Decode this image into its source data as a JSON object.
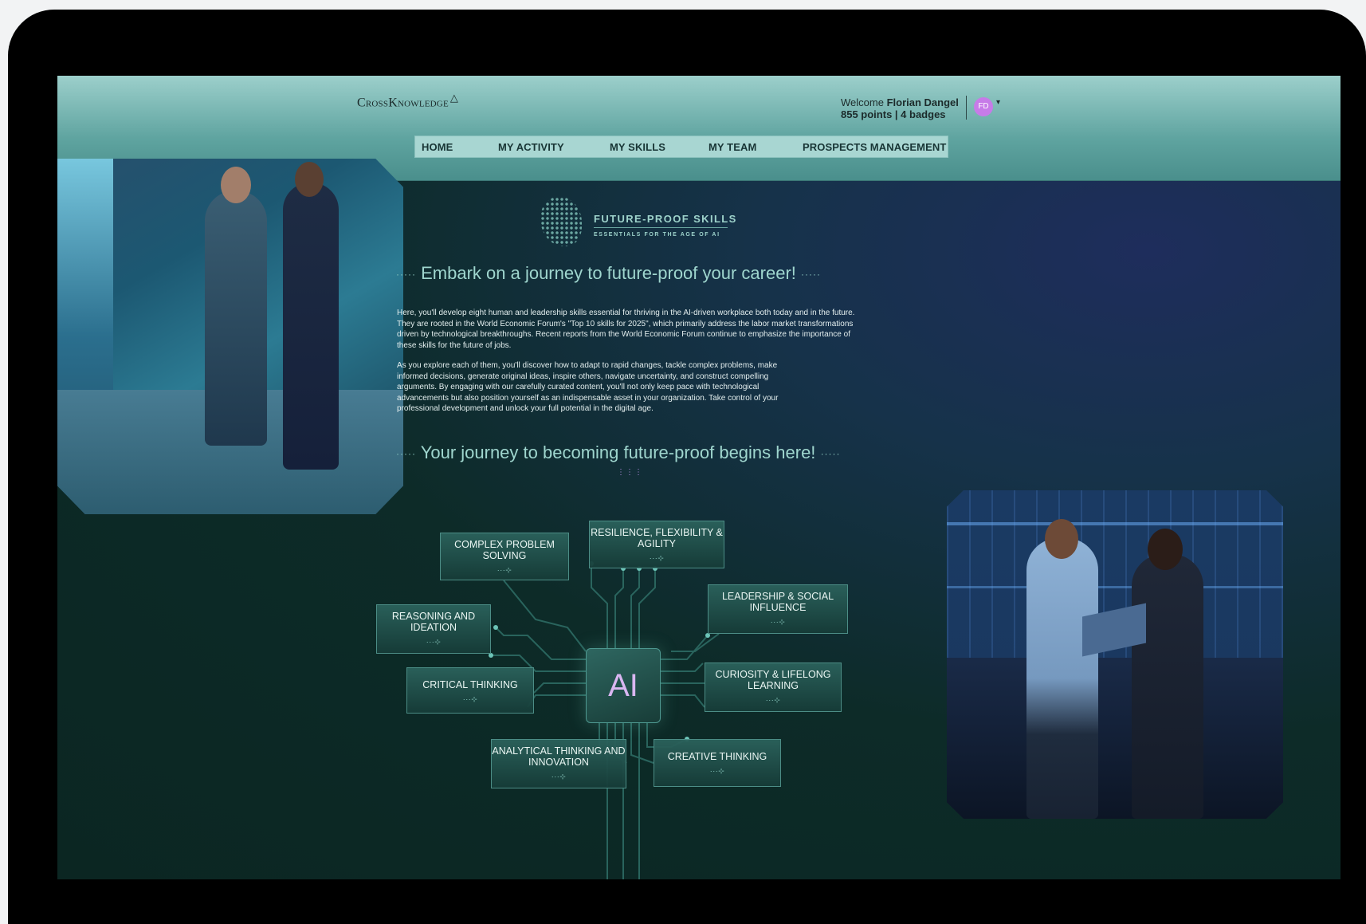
{
  "header": {
    "logo_text": "CrossKnowledge",
    "welcome_prefix": "Welcome",
    "user_name": "Florian Dangel",
    "points": "855 points",
    "separator": " | ",
    "badges": "4 badges",
    "avatar_initials": "FD",
    "caret": "▾"
  },
  "nav": {
    "items": [
      {
        "label": "HOME"
      },
      {
        "label": "MY ACTIVITY"
      },
      {
        "label": "MY SKILLS"
      },
      {
        "label": "MY TEAM"
      },
      {
        "label": "PROSPECTS MANAGEMENT"
      }
    ]
  },
  "banner": {
    "title": "FUTURE-PROOF SKILLS",
    "subtitle": "ESSENTIALS FOR THE AGE OF AI"
  },
  "intro": {
    "heading": "Embark on a journey to future-proof your career!",
    "dots": "·····",
    "paragraph1": "Here, you'll develop eight human and leadership skills essential for thriving in the AI-driven workplace both today and in the future. They are rooted in the World Economic Forum's \"Top 10 skills for 2025\", which primarily address the labor market transformations driven by technological breakthroughs. Recent reports from the World Economic Forum continue to emphasize the importance of these skills for the future of jobs.",
    "paragraph2": "As you explore each of them, you'll discover how to adapt to rapid changes, tackle complex problems, make informed decisions, generate original ideas, inspire others, navigate uncertainty, and construct compelling arguments. By engaging with our carefully curated content, you'll not only keep pace with technological advancements but also position yourself as an indispensable asset in your organization. Take control of your professional development and unlock your full potential in the digital age."
  },
  "journey": {
    "heading": "Your journey to becoming future-proof begins here!",
    "dots": "·····",
    "arrow": "⋮⋮⋮"
  },
  "diagram": {
    "center_label": "AI",
    "arrow_glyph": "···⊹",
    "skills": [
      {
        "label": "COMPLEX PROBLEM SOLVING"
      },
      {
        "label": "RESILIENCE, FLEXIBILITY & AGILITY"
      },
      {
        "label": "REASONING AND IDEATION"
      },
      {
        "label": "LEADERSHIP & SOCIAL INFLUENCE"
      },
      {
        "label": "CRITICAL THINKING"
      },
      {
        "label": "CURIOSITY & LIFELONG LEARNING"
      },
      {
        "label": "ANALYTICAL THINKING AND INNOVATION"
      },
      {
        "label": "CREATIVE THINKING"
      }
    ]
  },
  "colors": {
    "header_top": "#9ccfcb",
    "nav_bg": "#a8d6d2",
    "page_bg": "#0b2a26",
    "accent_text": "#9fd6ce",
    "ai_text": "#d9b6f1",
    "avatar_bg": "#c77be8"
  },
  "icons": {
    "logo_mark": "triangle-outline-icon",
    "user_menu": "chevron-down-icon",
    "skill_arrow": "dotted-arrow-icon",
    "banner_mark": "dotted-head-icon"
  }
}
